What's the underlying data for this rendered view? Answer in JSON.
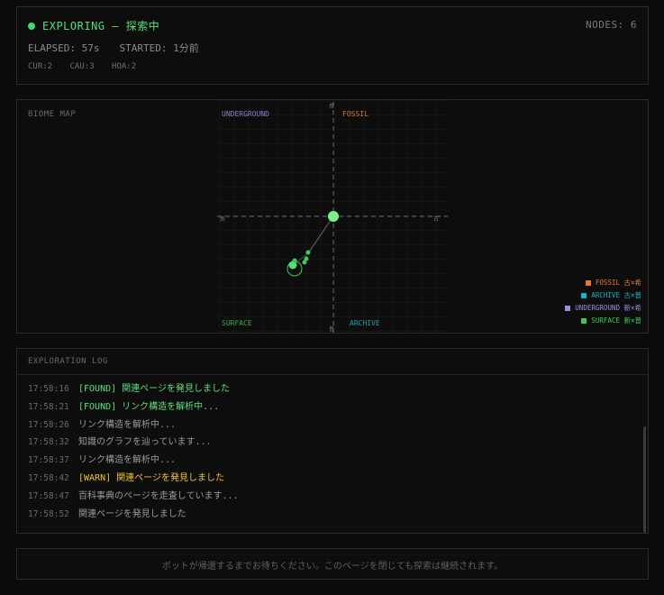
{
  "status": {
    "state_text": "EXPLORING — 探索中",
    "nodes_text": "NODES: 6",
    "elapsed_text": "ELAPSED: 57s",
    "started_text": "STARTED: 1分前",
    "counts": [
      "CUR:2",
      "CAU:3",
      "HOA:2"
    ],
    "indicator_color": "#3ddc6b"
  },
  "map": {
    "title": "BIOME MAP",
    "quadrants": {
      "underground": "UNDERGROUND",
      "fossil": "FOSSIL",
      "surface": "SURFACE",
      "archive": "ARCHIVE"
    },
    "axes": {
      "top": "希",
      "bottom": "普",
      "left": "新",
      "right": "古"
    },
    "legend": [
      {
        "label": "FOSSIL 古×希",
        "color": "#e07a3c"
      },
      {
        "label": "ARCHIVE 古×普",
        "color": "#1fb0c0"
      },
      {
        "label": "UNDERGROUND 新×希",
        "color": "#9b8fe0"
      },
      {
        "label": "SURFACE 新×普",
        "color": "#3ec85a"
      }
    ]
  },
  "log": {
    "title": "EXPLORATION LOG",
    "entries": [
      {
        "time": "17:58:16",
        "msg": "[FOUND] 関連ページを発見しました",
        "level": "found"
      },
      {
        "time": "17:58:21",
        "msg": "[FOUND] リンク構造を解析中...",
        "level": "found"
      },
      {
        "time": "17:58:26",
        "msg": "リンク構造を解析中...",
        "level": "info"
      },
      {
        "time": "17:58:32",
        "msg": "知識のグラフを辿っています...",
        "level": "info"
      },
      {
        "time": "17:58:37",
        "msg": "リンク構造を解析中...",
        "level": "info"
      },
      {
        "time": "17:58:42",
        "msg": "[WARN] 関連ページを発見しました",
        "level": "warn"
      },
      {
        "time": "17:58:47",
        "msg": "百科事典のページを走査しています...",
        "level": "info"
      },
      {
        "time": "17:58:52",
        "msg": "関連ページを発見しました",
        "level": "info"
      }
    ]
  },
  "footer": {
    "text": "ボットが帰還するまでお待ちください。このページを閉じても探索は継続されます。"
  }
}
